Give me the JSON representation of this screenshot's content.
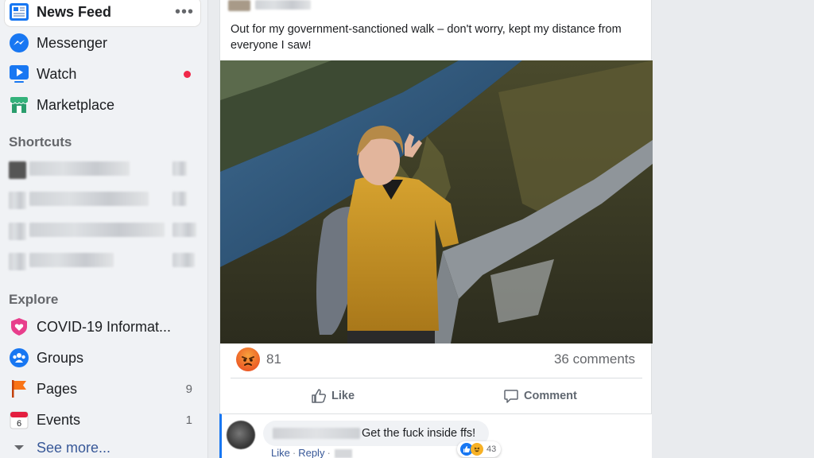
{
  "sidebar": {
    "main_items": [
      {
        "label": "News Feed",
        "icon": "news-feed-icon",
        "more": "•••"
      },
      {
        "label": "Messenger",
        "icon": "messenger-icon"
      },
      {
        "label": "Watch",
        "icon": "watch-icon"
      },
      {
        "label": "Marketplace",
        "icon": "marketplace-icon"
      }
    ],
    "shortcuts_header": "Shortcuts",
    "explore_header": "Explore",
    "explore_items": [
      {
        "label": "COVID-19 Informat...",
        "icon": "covid-heart-icon"
      },
      {
        "label": "Groups",
        "icon": "groups-icon"
      },
      {
        "label": "Pages",
        "icon": "pages-flag-icon",
        "count": "9"
      },
      {
        "label": "Events",
        "icon": "calendar-icon",
        "count": "1",
        "calendar_day": "6"
      }
    ],
    "see_more": "See more..."
  },
  "post": {
    "text": "Out for my government-sanctioned walk – don't worry, kept my distance from everyone I saw!",
    "reaction_count": "81",
    "comments_count": "36 comments",
    "like_label": "Like",
    "comment_label": "Comment"
  },
  "comment": {
    "text": "Get the fuck inside ffs!",
    "like": "Like",
    "sep": "·",
    "reply": "Reply",
    "reaction_count": "43"
  },
  "colors": {
    "accent": "#1877f2",
    "sidebar_bg": "#f0f2f5",
    "notification_dot": "#f02849",
    "angry_reaction": "#ef6b2b",
    "link": "#385898"
  }
}
